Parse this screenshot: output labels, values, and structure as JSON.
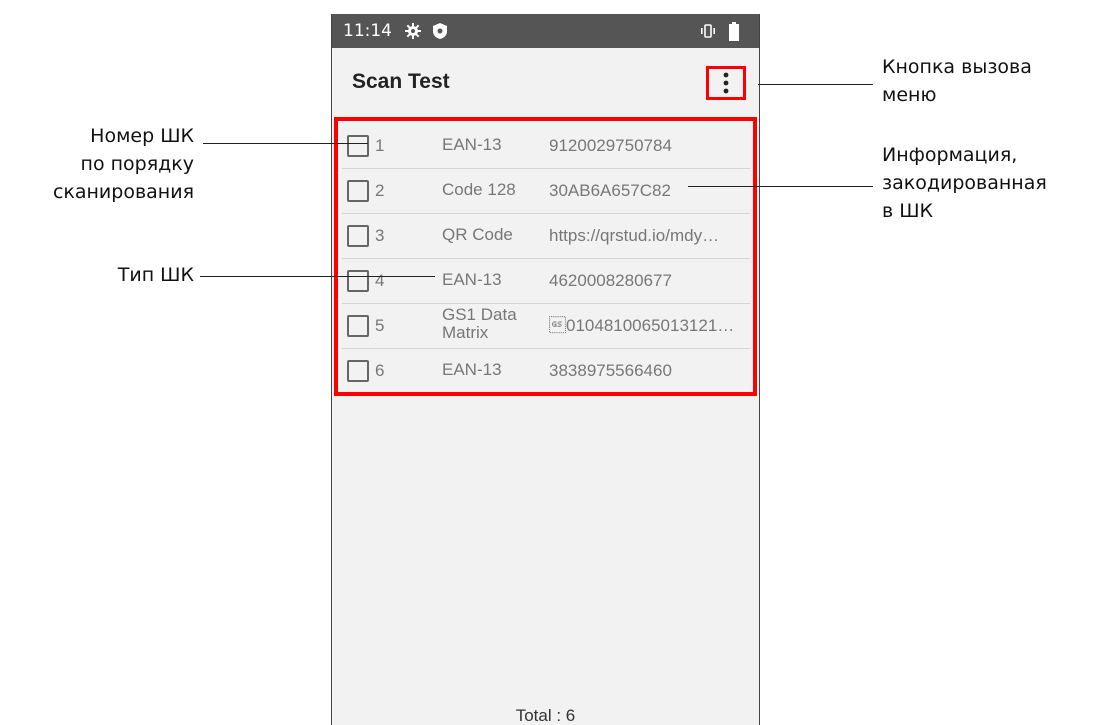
{
  "status_bar": {
    "time": "11:14",
    "icons": [
      "settings-gear-icon",
      "shield-icon",
      "vibrate-icon",
      "battery-icon"
    ]
  },
  "app_bar": {
    "title": "Scan Test",
    "menu_icon": "more-vert-icon"
  },
  "barcode_list": [
    {
      "index": "1",
      "type": "EAN-13",
      "value": "9120029750784"
    },
    {
      "index": "2",
      "type": "Code 128",
      "value": "30AB6A657C82"
    },
    {
      "index": "3",
      "type": "QR Code",
      "value": "https://qrstud.io/mdy…"
    },
    {
      "index": "4",
      "type": "EAN-13",
      "value": "4620008280677"
    },
    {
      "index": "5",
      "type": "GS1 Data Matrix",
      "type_line1": "GS1 Data",
      "type_line2": "Matrix",
      "value": "\u001d0104810065013121…"
    },
    {
      "index": "6",
      "type": "EAN-13",
      "value": "3838975566460"
    }
  ],
  "footer": {
    "total": "Total : 6"
  },
  "annotations": {
    "number": [
      "Номер ШК",
      "по порядку",
      "сканирования"
    ],
    "type": [
      "Тип ШК"
    ],
    "menu": [
      "Кнопка вызова",
      "меню"
    ],
    "info": [
      "Информация,",
      "закодированная",
      "в ШК"
    ]
  },
  "colors": {
    "highlight": "#ff0000",
    "status_bar": "#555555",
    "background": "#f2f2f2"
  }
}
